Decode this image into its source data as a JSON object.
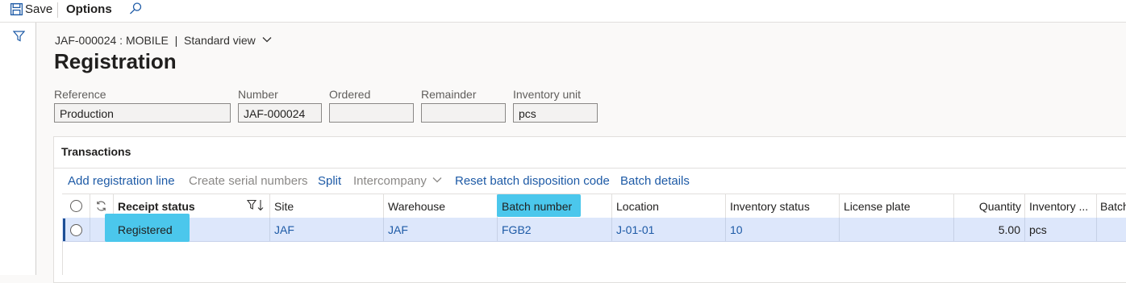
{
  "toolbar": {
    "save": "Save",
    "options": "Options"
  },
  "header": {
    "breadcrumb": "JAF-000024 : MOBILE  |  Standard view",
    "title": "Registration"
  },
  "fields": [
    {
      "label": "Reference",
      "value": "Production"
    },
    {
      "label": "Number",
      "value": "JAF-000024"
    },
    {
      "label": "Ordered",
      "value": ""
    },
    {
      "label": "Remainder",
      "value": ""
    },
    {
      "label": "Inventory unit",
      "value": "pcs"
    }
  ],
  "transactions": {
    "title": "Transactions",
    "actions": {
      "add_line": "Add registration line",
      "create_serial": "Create serial numbers",
      "split": "Split",
      "intercompany": "Intercompany",
      "reset_batch": "Reset batch disposition code",
      "batch_details": "Batch details"
    },
    "columns": {
      "receipt_status": "Receipt status",
      "site": "Site",
      "warehouse": "Warehouse",
      "batch_number": "Batch number",
      "location": "Location",
      "inventory_status": "Inventory status",
      "license_plate": "License plate",
      "quantity": "Quantity",
      "inventory_unit": "Inventory ...",
      "batch": "Batch"
    },
    "row": {
      "receipt_status": "Registered",
      "site": "JAF",
      "warehouse": "JAF",
      "batch_number": "FGB2",
      "location": "J-01-01",
      "inventory_status": "10",
      "license_plate": "",
      "quantity": "5.00",
      "inventory_unit": "pcs"
    }
  },
  "colors": {
    "accent": "#1d5aa6",
    "highlight": "#4bc7ec",
    "selected_row": "#dde7fb"
  }
}
